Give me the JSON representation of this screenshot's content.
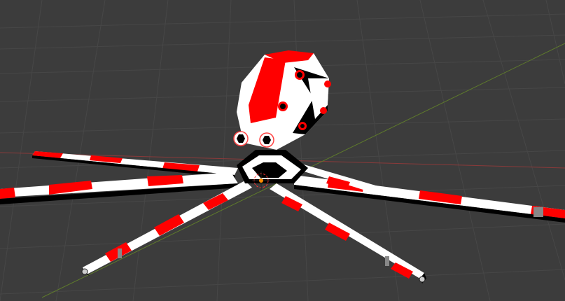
{
  "viewport": {
    "background": "#3c3c3c",
    "grid_color": "#464646",
    "x_axis_color": "#8a3a3a",
    "y_axis_color": "#5e7a2c"
  },
  "model": {
    "primary_color": "#ff0000",
    "secondary_color": "#ffffff",
    "shadow_color": "#000000",
    "tentacle_count": 8,
    "origin_color": "#ff8c00"
  }
}
